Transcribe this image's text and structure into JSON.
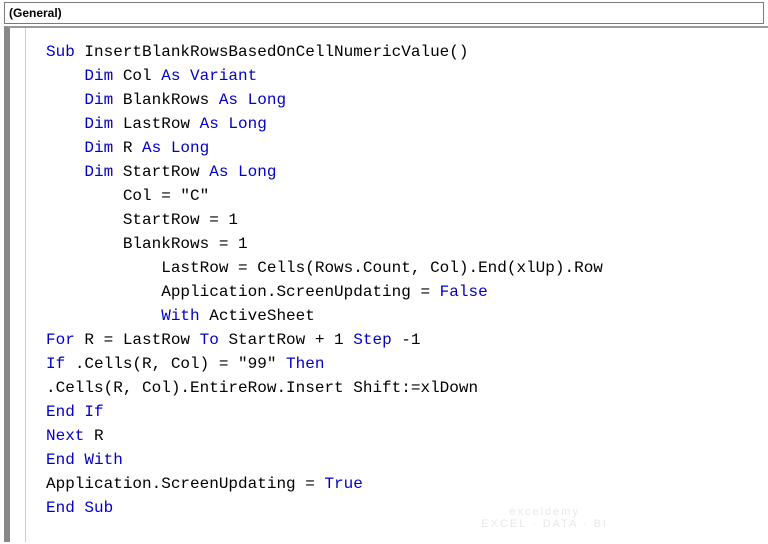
{
  "dropdown": {
    "label": "(General)"
  },
  "code": {
    "lines": [
      {
        "indent": 0,
        "segments": [
          {
            "t": "Sub ",
            "c": "kw"
          },
          {
            "t": "InsertBlankRowsBasedOnCellNumericValue()",
            "c": "txt"
          }
        ]
      },
      {
        "indent": 1,
        "segments": [
          {
            "t": "Dim ",
            "c": "kw"
          },
          {
            "t": "Col ",
            "c": "txt"
          },
          {
            "t": "As Variant",
            "c": "kw"
          }
        ]
      },
      {
        "indent": 1,
        "segments": [
          {
            "t": "Dim ",
            "c": "kw"
          },
          {
            "t": "BlankRows ",
            "c": "txt"
          },
          {
            "t": "As Long",
            "c": "kw"
          }
        ]
      },
      {
        "indent": 1,
        "segments": [
          {
            "t": "Dim ",
            "c": "kw"
          },
          {
            "t": "LastRow ",
            "c": "txt"
          },
          {
            "t": "As Long",
            "c": "kw"
          }
        ]
      },
      {
        "indent": 1,
        "segments": [
          {
            "t": "Dim ",
            "c": "kw"
          },
          {
            "t": "R ",
            "c": "txt"
          },
          {
            "t": "As Long",
            "c": "kw"
          }
        ]
      },
      {
        "indent": 1,
        "segments": [
          {
            "t": "Dim ",
            "c": "kw"
          },
          {
            "t": "StartRow ",
            "c": "txt"
          },
          {
            "t": "As Long",
            "c": "kw"
          }
        ]
      },
      {
        "indent": 2,
        "segments": [
          {
            "t": "Col = \"C\"",
            "c": "txt"
          }
        ]
      },
      {
        "indent": 2,
        "segments": [
          {
            "t": "StartRow = 1",
            "c": "txt"
          }
        ]
      },
      {
        "indent": 2,
        "segments": [
          {
            "t": "BlankRows = 1",
            "c": "txt"
          }
        ]
      },
      {
        "indent": 3,
        "segments": [
          {
            "t": "LastRow = Cells(Rows.Count, Col).End(xlUp).Row",
            "c": "txt"
          }
        ]
      },
      {
        "indent": 3,
        "segments": [
          {
            "t": "Application.ScreenUpdating = ",
            "c": "txt"
          },
          {
            "t": "False",
            "c": "kw"
          }
        ]
      },
      {
        "indent": 3,
        "segments": [
          {
            "t": "With ",
            "c": "kw"
          },
          {
            "t": "ActiveSheet",
            "c": "txt"
          }
        ]
      },
      {
        "indent": 0,
        "segments": [
          {
            "t": "For ",
            "c": "kw"
          },
          {
            "t": "R = LastRow ",
            "c": "txt"
          },
          {
            "t": "To ",
            "c": "kw"
          },
          {
            "t": "StartRow + 1 ",
            "c": "txt"
          },
          {
            "t": "Step ",
            "c": "kw"
          },
          {
            "t": "-1",
            "c": "txt"
          }
        ]
      },
      {
        "indent": 0,
        "segments": [
          {
            "t": "If ",
            "c": "kw"
          },
          {
            "t": ".Cells(R, Col) = \"99\" ",
            "c": "txt"
          },
          {
            "t": "Then",
            "c": "kw"
          }
        ]
      },
      {
        "indent": 0,
        "segments": [
          {
            "t": ".Cells(R, Col).EntireRow.Insert Shift:=xlDown",
            "c": "txt"
          }
        ]
      },
      {
        "indent": 0,
        "segments": [
          {
            "t": "End If",
            "c": "kw"
          }
        ]
      },
      {
        "indent": 0,
        "segments": [
          {
            "t": "Next ",
            "c": "kw"
          },
          {
            "t": "R",
            "c": "txt"
          }
        ]
      },
      {
        "indent": 0,
        "segments": [
          {
            "t": "End With",
            "c": "kw"
          }
        ]
      },
      {
        "indent": 0,
        "segments": [
          {
            "t": "Application.ScreenUpdating = ",
            "c": "txt"
          },
          {
            "t": "True",
            "c": "kw"
          }
        ]
      },
      {
        "indent": 0,
        "segments": [
          {
            "t": "End Sub",
            "c": "kw"
          }
        ]
      }
    ]
  },
  "watermark": {
    "line1": "exceldemy",
    "line2": "EXCEL · DATA · BI"
  }
}
